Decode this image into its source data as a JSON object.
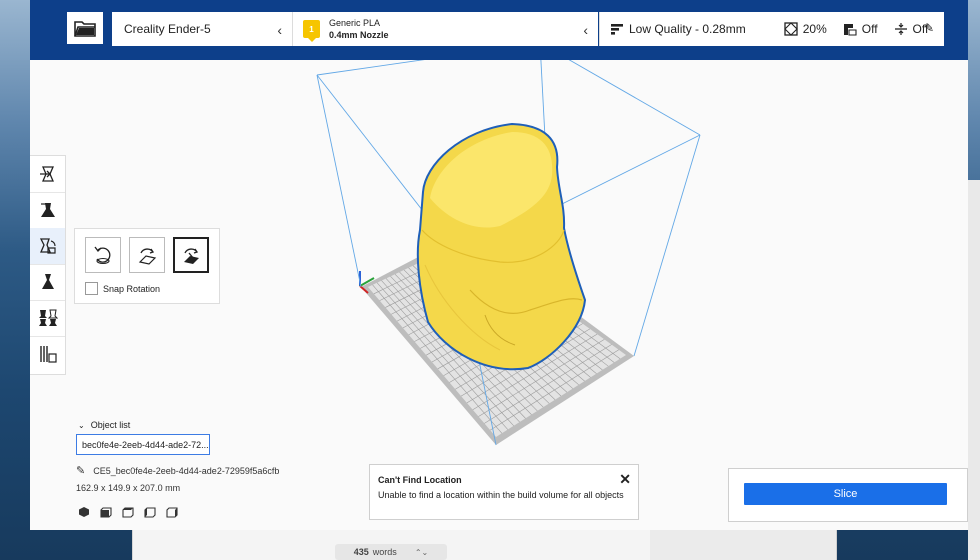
{
  "topbar": {
    "printer": "Creality Ender-5",
    "material": {
      "badge": "1",
      "name": "Generic PLA",
      "nozzle": "0.4mm Nozzle"
    },
    "quality": {
      "profile": "Low Quality - 0.28mm",
      "infill": "20%",
      "support": "Off",
      "adhesion": "Off"
    }
  },
  "rotate_tool": {
    "snap_label": "Snap Rotation"
  },
  "object_list": {
    "toggle_label": "Object list",
    "selected": "bec0fe4e-2eeb-4d44-ade2-72...",
    "object_name": "CE5_bec0fe4e-2eeb-4d44-ade2-72959f5a6cfb",
    "dimensions": "162.9 x 149.9 x 207.0 mm"
  },
  "toast": {
    "title": "Can't Find Location",
    "message": "Unable to find a location within the build volume for all objects"
  },
  "slice": {
    "label": "Slice"
  },
  "document": {
    "word_count": "435",
    "word_label": "words"
  },
  "colors": {
    "header": "#0d3f8a",
    "accent": "#1a6fe8",
    "model": "#f7de4f",
    "plate": "#c8c8c8"
  }
}
